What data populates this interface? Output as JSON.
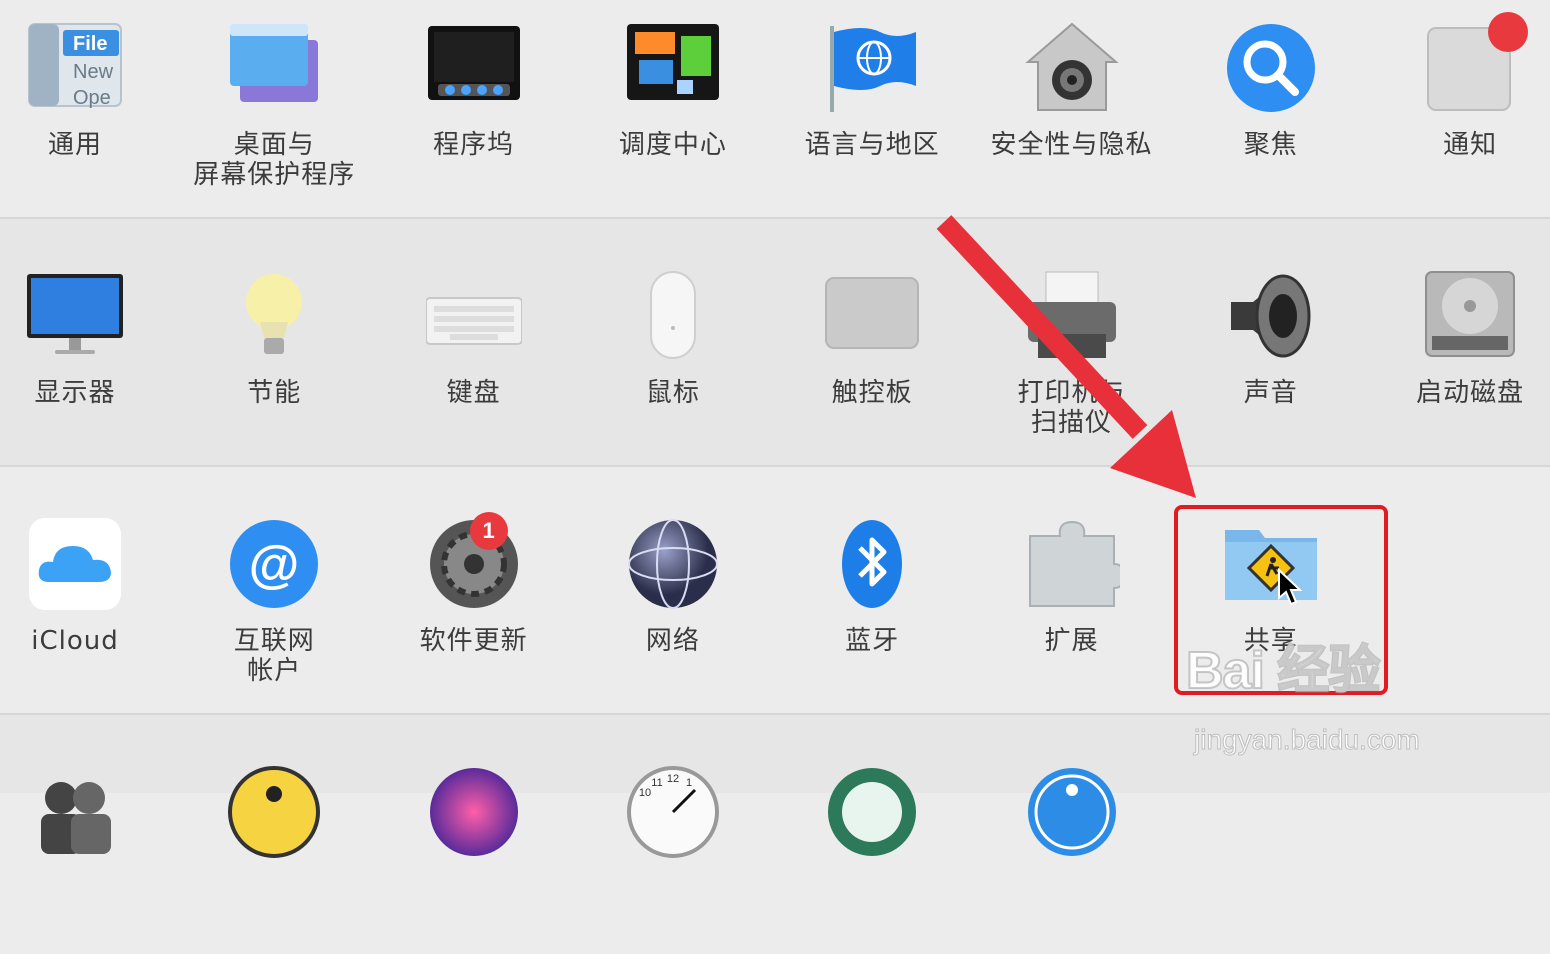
{
  "rows": [
    [
      {
        "name": "pane-general",
        "icon": "general-icon",
        "label": "通用"
      },
      {
        "name": "pane-desktop-screensaver",
        "icon": "desktop-screensaver-icon",
        "label": "桌面与\n屏幕保护程序"
      },
      {
        "name": "pane-dock",
        "icon": "dock-icon",
        "label": "程序坞"
      },
      {
        "name": "pane-mission-control",
        "icon": "mission-control-icon",
        "label": "调度中心"
      },
      {
        "name": "pane-language-region",
        "icon": "language-region-icon",
        "label": "语言与地区"
      },
      {
        "name": "pane-security-privacy",
        "icon": "security-privacy-icon",
        "label": "安全性与隐私"
      },
      {
        "name": "pane-spotlight",
        "icon": "spotlight-icon",
        "label": "聚焦"
      },
      {
        "name": "pane-notifications",
        "icon": "notifications-icon",
        "label": "通知"
      }
    ],
    [
      {
        "name": "pane-displays",
        "icon": "displays-icon",
        "label": "显示器"
      },
      {
        "name": "pane-energy-saver",
        "icon": "energy-saver-icon",
        "label": "节能"
      },
      {
        "name": "pane-keyboard",
        "icon": "keyboard-icon",
        "label": "键盘"
      },
      {
        "name": "pane-mouse",
        "icon": "mouse-icon",
        "label": "鼠标"
      },
      {
        "name": "pane-trackpad",
        "icon": "trackpad-icon",
        "label": "触控板"
      },
      {
        "name": "pane-printers-scanners",
        "icon": "printer-icon",
        "label": "打印机与\n扫描仪"
      },
      {
        "name": "pane-sound",
        "icon": "sound-icon",
        "label": "声音"
      },
      {
        "name": "pane-startup-disk",
        "icon": "startup-disk-icon",
        "label": "启动磁盘"
      }
    ],
    [
      {
        "name": "pane-icloud",
        "icon": "icloud-icon",
        "label": "iCloud"
      },
      {
        "name": "pane-internet-accounts",
        "icon": "internet-accounts-icon",
        "label": "互联网\n帐户"
      },
      {
        "name": "pane-software-update",
        "icon": "software-update-icon",
        "label": "软件更新",
        "badge": "1"
      },
      {
        "name": "pane-network",
        "icon": "network-icon",
        "label": "网络"
      },
      {
        "name": "pane-bluetooth",
        "icon": "bluetooth-icon",
        "label": "蓝牙"
      },
      {
        "name": "pane-extensions",
        "icon": "extensions-icon",
        "label": "扩展"
      },
      {
        "name": "pane-sharing",
        "icon": "sharing-icon",
        "label": "共享"
      }
    ],
    [
      {
        "name": "pane-users-groups",
        "icon": "users-groups-icon",
        "label": ""
      },
      {
        "name": "pane-parental-controls",
        "icon": "parental-controls-icon",
        "label": ""
      },
      {
        "name": "pane-siri",
        "icon": "siri-icon",
        "label": ""
      },
      {
        "name": "pane-date-time",
        "icon": "date-time-icon",
        "label": ""
      },
      {
        "name": "pane-time-machine",
        "icon": "time-machine-icon",
        "label": ""
      },
      {
        "name": "pane-accessibility",
        "icon": "accessibility-icon",
        "label": ""
      }
    ]
  ],
  "icon_tiles": {
    "general": {
      "line1": "File",
      "line2": "New",
      "line3": "Ope"
    },
    "date_time": {
      "n1": "11",
      "n2": "12",
      "n3": "1",
      "n4": "10"
    }
  },
  "annotations": {
    "highlight_color": "#e11b22",
    "arrow_color": "#e11b22",
    "watermark_brand": "Bai  经验",
    "watermark_url": "jingyan.baidu.com"
  }
}
